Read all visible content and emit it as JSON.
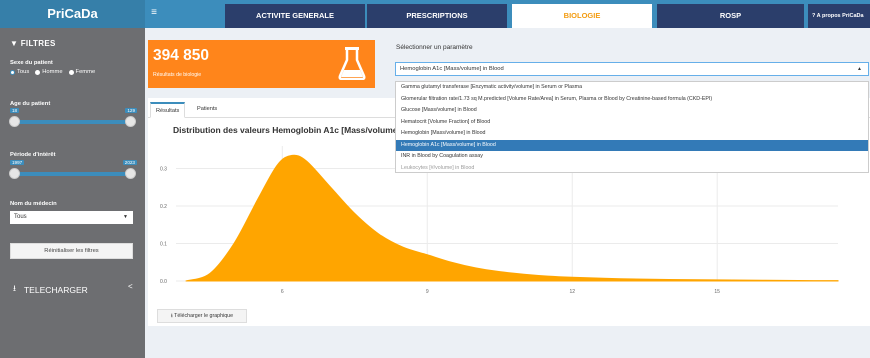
{
  "app": {
    "title": "PriCaDa",
    "menu_icon": "≡"
  },
  "nav": {
    "tabs": [
      {
        "label": "ACTIVITE GENERALE"
      },
      {
        "label": "PRESCRIPTIONS"
      },
      {
        "label": "BIOLOGIE"
      },
      {
        "label": "ROSP"
      }
    ],
    "about_label": "?    A propos PriCaDa"
  },
  "sidebar": {
    "filters_title": "FILTRES",
    "sex_label": "Sexe du patient",
    "sex_options": [
      "Tous",
      "Homme",
      "Femme"
    ],
    "sex_selected": "Tous",
    "age_label": "Age du patient",
    "age_min": "18",
    "age_max": "129",
    "period_label": "Période d'intérêt",
    "period_min": "1997",
    "period_max": "2023",
    "doctor_label": "Nom du médecin",
    "doctor_value": "Tous",
    "reset_label": "Réinitialiser les filtres",
    "download_label": "TELECHARGER"
  },
  "infobox": {
    "value": "394 850",
    "label": "Résultats de biologie",
    "icon": "flask-icon"
  },
  "parameter": {
    "label": "Sélectionner un paramètre",
    "selected": "Hemoglobin A1c [Mass/volume] in Blood",
    "options": [
      "Gamma glutamyl transferase [Enzymatic activity/volume] in Serum or Plasma",
      "Glomerular filtration rate/1.73 sq M.predicted [Volume Rate/Area] in Serum, Plasma or Blood by Creatinine-based formula (CKD-EPI)",
      "Glucose [Mass/volume] in Blood",
      "Hematocrit [Volume Fraction] of Blood",
      "Hemoglobin [Mass/volume] in Blood",
      "Hemoglobin A1c [Mass/volume] in Blood",
      "INR in Blood by Coagulation assay",
      "Leukocytes [#/volume] in Blood"
    ]
  },
  "panel": {
    "tabs": [
      "Résultats",
      "Patients"
    ],
    "active_tab": "Résultats",
    "download_chart_label": "Télécharger le graphique"
  },
  "chart_data": {
    "type": "area",
    "title": "Distribution des valeurs Hemoglobin A1c [Mass/volume]",
    "xlabel": "",
    "ylabel": "",
    "x_ticks": [
      6,
      9,
      12,
      15
    ],
    "y_ticks": [
      0.0,
      0.1,
      0.2,
      0.3
    ],
    "xlim": [
      3.8,
      17.5
    ],
    "ylim": [
      0,
      0.36
    ],
    "grid": true,
    "fill": "#ffa500",
    "x": [
      4.0,
      4.5,
      5.0,
      5.5,
      5.9,
      6.2,
      6.5,
      7.0,
      7.5,
      8.0,
      8.5,
      9.0,
      9.5,
      10.0,
      10.5,
      11.0,
      11.5,
      12.0,
      13.0,
      14.0,
      15.0,
      16.0,
      17.0,
      17.5
    ],
    "y": [
      0.0,
      0.02,
      0.1,
      0.22,
      0.31,
      0.335,
      0.32,
      0.25,
      0.18,
      0.125,
      0.09,
      0.07,
      0.05,
      0.035,
      0.025,
      0.018,
      0.013,
      0.01,
      0.006,
      0.004,
      0.003,
      0.002,
      0.001,
      0.001
    ]
  },
  "colors": {
    "header": "#3c8dbc",
    "nav_tab": "#2b3e6b",
    "sidebar": "#6d6e71",
    "accent": "#f39c12",
    "infobox": "#ff851b",
    "selected_option": "#337ab7"
  }
}
